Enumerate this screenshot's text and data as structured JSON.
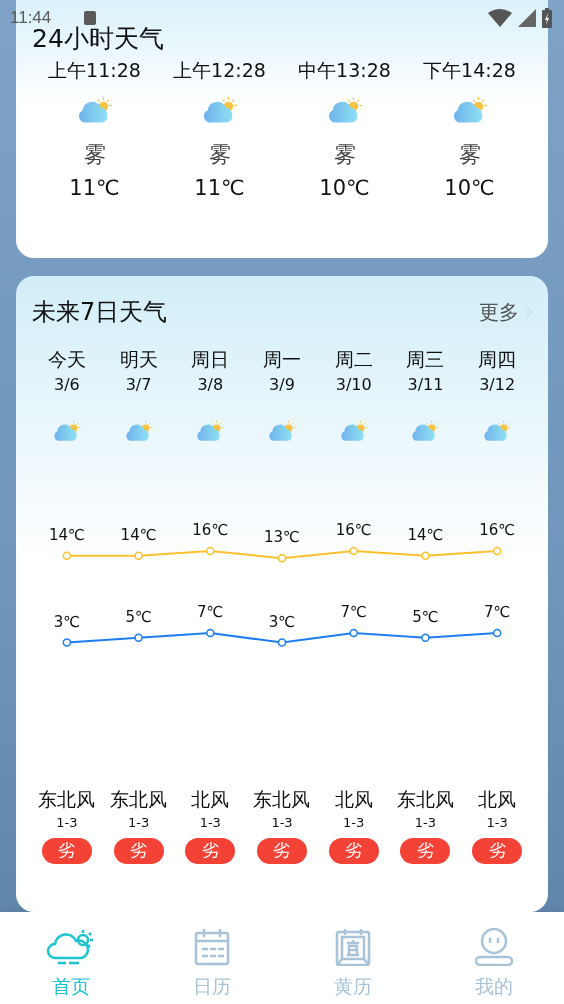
{
  "status_bar": {
    "time": "11:44"
  },
  "hourly": {
    "title": "24小时天气",
    "items": [
      {
        "time": "上午11:28",
        "condition": "雾",
        "temp": "11℃"
      },
      {
        "time": "上午12:28",
        "condition": "雾",
        "temp": "11℃"
      },
      {
        "time": "中午13:28",
        "condition": "雾",
        "temp": "10℃"
      },
      {
        "time": "下午14:28",
        "condition": "雾",
        "temp": "10℃"
      }
    ]
  },
  "daily": {
    "title": "未来7日天气",
    "more": "更多",
    "days": [
      {
        "day": "今天",
        "date": "3/6",
        "wind": "东北风",
        "wind_level": "1-3",
        "air": "劣"
      },
      {
        "day": "明天",
        "date": "3/7",
        "wind": "东北风",
        "wind_level": "1-3",
        "air": "劣"
      },
      {
        "day": "周日",
        "date": "3/8",
        "wind": "北风",
        "wind_level": "1-3",
        "air": "劣"
      },
      {
        "day": "周一",
        "date": "3/9",
        "wind": "东北风",
        "wind_level": "1-3",
        "air": "劣"
      },
      {
        "day": "周二",
        "date": "3/10",
        "wind": "北风",
        "wind_level": "1-3",
        "air": "劣"
      },
      {
        "day": "周三",
        "date": "3/11",
        "wind": "东北风",
        "wind_level": "1-3",
        "air": "劣"
      },
      {
        "day": "周四",
        "date": "3/12",
        "wind": "北风",
        "wind_level": "1-3",
        "air": "劣"
      }
    ],
    "high_chart": {
      "chart_data": {
        "type": "line",
        "data_labels": true,
        "series": [
          {
            "color": "#fbc02d",
            "marker": "circle",
            "values": [
              14,
              14,
              16,
              13,
              16,
              14,
              16
            ],
            "value_labels": [
              "14℃",
              "14℃",
              "16℃",
              "13℃",
              "16℃",
              "14℃",
              "16℃"
            ]
          }
        ]
      }
    },
    "low_chart": {
      "chart_data": {
        "type": "line",
        "data_labels": true,
        "series": [
          {
            "color": "#1e7ef0",
            "marker": "circle",
            "values": [
              3,
              5,
              7,
              3,
              7,
              5,
              7
            ],
            "value_labels": [
              "3℃",
              "5℃",
              "7℃",
              "3℃",
              "7℃",
              "5℃",
              "7℃"
            ]
          }
        ]
      }
    }
  },
  "tab_bar": [
    {
      "label": "首页",
      "kind": "weather",
      "selected": true
    },
    {
      "label": "日历",
      "kind": "calendar",
      "selected": false
    },
    {
      "label": "黄历",
      "kind": "almanac",
      "selected": false
    },
    {
      "label": "我的",
      "kind": "profile",
      "selected": false
    }
  ]
}
